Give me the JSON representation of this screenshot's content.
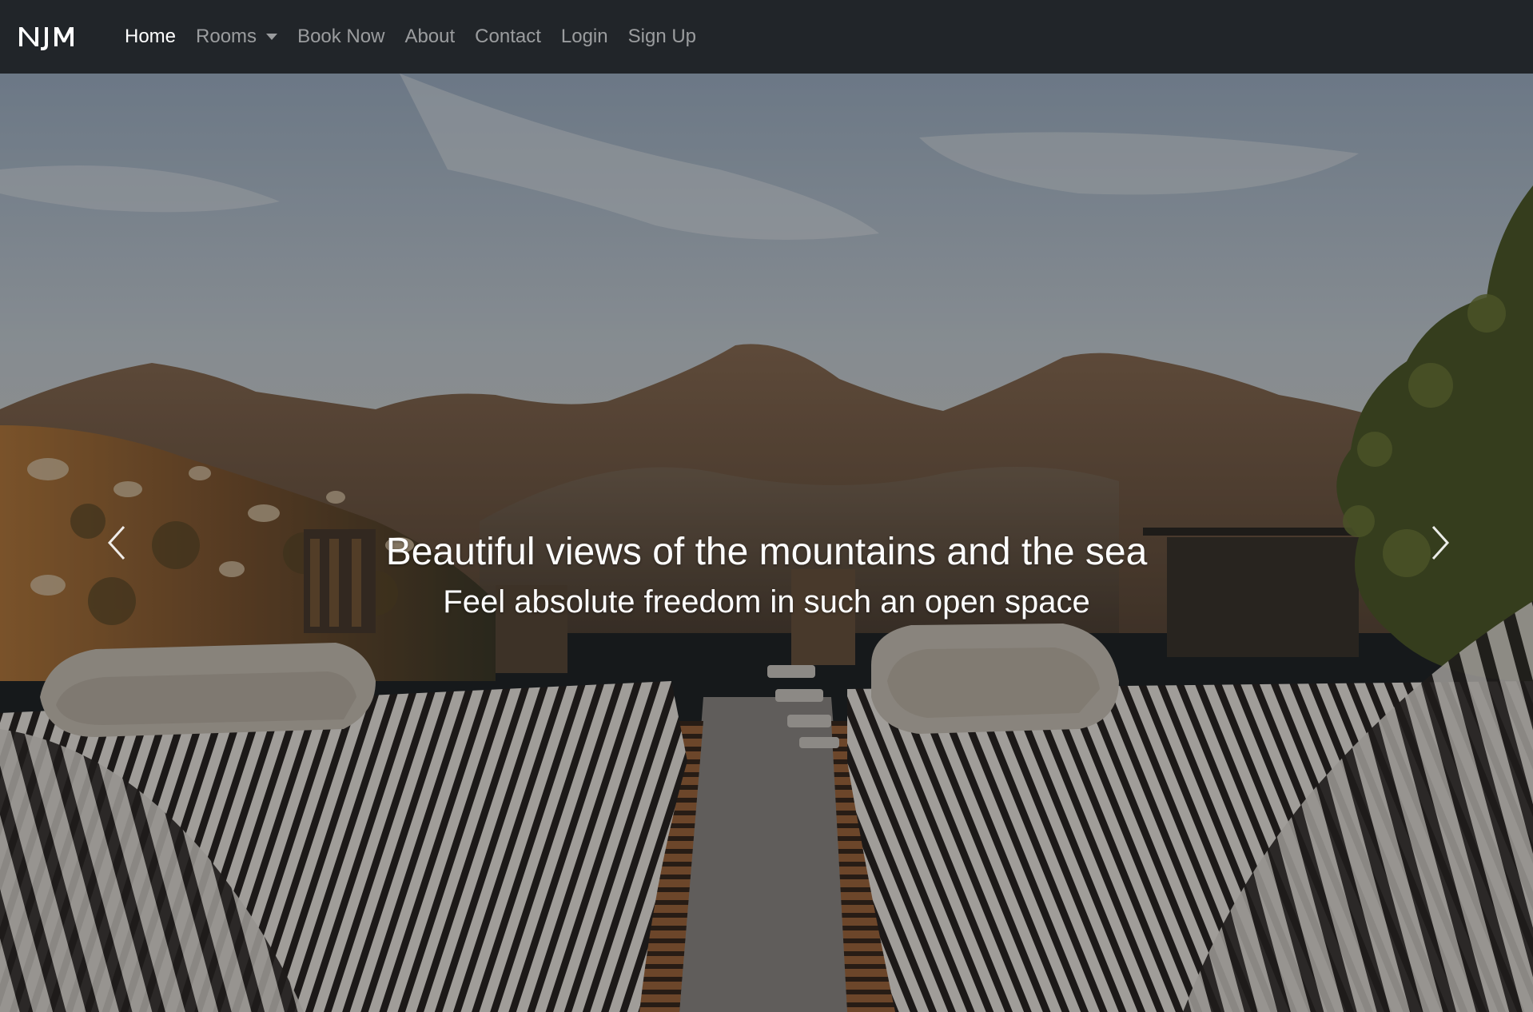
{
  "navbar": {
    "brand": "NJM",
    "items": [
      {
        "label": "Home",
        "active": true
      },
      {
        "label": "Rooms",
        "dropdown": true
      },
      {
        "label": "Book Now"
      },
      {
        "label": "About"
      },
      {
        "label": "Contact"
      },
      {
        "label": "Login"
      },
      {
        "label": "Sign Up"
      }
    ]
  },
  "carousel": {
    "title": "Beautiful views of the mountains and the sea",
    "subtitle": "Feel absolute freedom in such an open space",
    "prev_icon": "chevron-left-icon",
    "next_icon": "chevron-right-icon"
  },
  "colors": {
    "navbar_bg": "#212529",
    "nav_active": "#ffffff",
    "nav_inactive": "rgba(255,255,255,0.55)"
  }
}
